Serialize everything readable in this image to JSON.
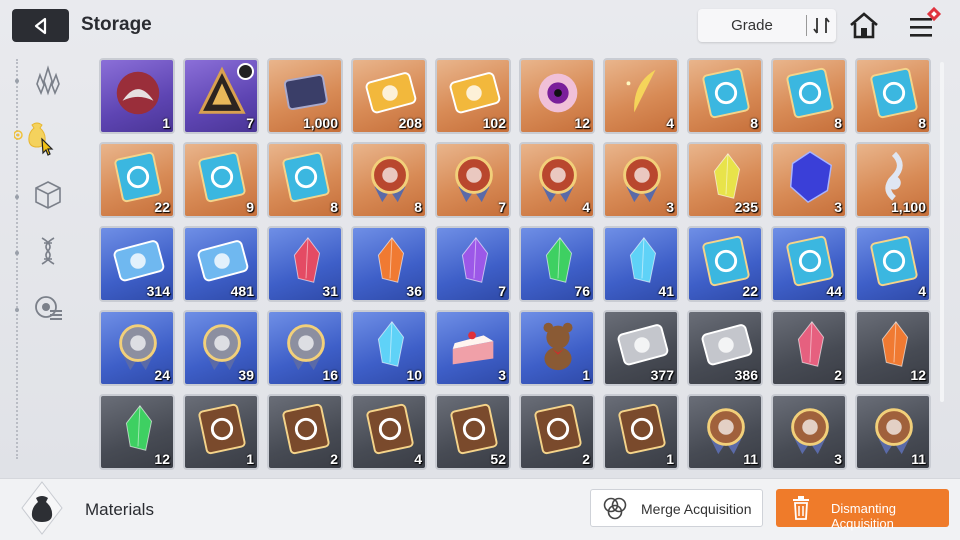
{
  "header": {
    "title": "Storage",
    "grade_label": "Grade"
  },
  "sidebar": {
    "categories": [
      {
        "name": "crystal",
        "active": false
      },
      {
        "name": "bag",
        "active": true
      },
      {
        "name": "cube",
        "active": false
      },
      {
        "name": "dna",
        "active": false
      },
      {
        "name": "chip",
        "active": false
      }
    ]
  },
  "items": [
    {
      "rarity": "purple",
      "icon": "monster-core",
      "count": "1"
    },
    {
      "rarity": "purple",
      "icon": "triangle-relic",
      "count": "7",
      "timer": true
    },
    {
      "rarity": "orange",
      "icon": "chip-card",
      "count": "1,000"
    },
    {
      "rarity": "orange",
      "icon": "gold-ticket",
      "count": "208"
    },
    {
      "rarity": "orange",
      "icon": "gold-ticket-rainbow",
      "count": "102"
    },
    {
      "rarity": "orange",
      "icon": "purple-eye",
      "count": "12"
    },
    {
      "rarity": "orange",
      "icon": "gold-feather",
      "count": "4"
    },
    {
      "rarity": "orange",
      "icon": "sword-book",
      "count": "8"
    },
    {
      "rarity": "orange",
      "icon": "shield-book",
      "count": "8"
    },
    {
      "rarity": "orange",
      "icon": "eye-book",
      "count": "8"
    },
    {
      "rarity": "orange",
      "icon": "sword-book",
      "count": "22"
    },
    {
      "rarity": "orange",
      "icon": "target-book",
      "count": "9"
    },
    {
      "rarity": "orange",
      "icon": "globe-book",
      "count": "8"
    },
    {
      "rarity": "orange",
      "icon": "sword-medal",
      "count": "8"
    },
    {
      "rarity": "orange",
      "icon": "shield-medal",
      "count": "7"
    },
    {
      "rarity": "orange",
      "icon": "arrow-medal",
      "count": "4"
    },
    {
      "rarity": "orange",
      "icon": "star-medal",
      "count": "3"
    },
    {
      "rarity": "orange",
      "icon": "yellow-crystal",
      "count": "235"
    },
    {
      "rarity": "orange",
      "icon": "blue-cube",
      "count": "3"
    },
    {
      "rarity": "orange",
      "icon": "music-clef",
      "count": "1,100"
    },
    {
      "rarity": "blue",
      "icon": "blue-ticket",
      "count": "314"
    },
    {
      "rarity": "blue",
      "icon": "compass-ticket",
      "count": "481"
    },
    {
      "rarity": "blue",
      "icon": "red-crystal",
      "count": "31"
    },
    {
      "rarity": "blue",
      "icon": "orange-crystal",
      "count": "36"
    },
    {
      "rarity": "blue",
      "icon": "purple-crystal",
      "count": "7"
    },
    {
      "rarity": "blue",
      "icon": "green-crystal",
      "count": "76"
    },
    {
      "rarity": "blue",
      "icon": "cyan-crystal",
      "count": "41"
    },
    {
      "rarity": "blue",
      "icon": "shield-book-blue",
      "count": "22"
    },
    {
      "rarity": "blue",
      "icon": "eye-book-blue",
      "count": "44"
    },
    {
      "rarity": "blue",
      "icon": "sword-book-blue",
      "count": "4"
    },
    {
      "rarity": "blue",
      "icon": "silver-medal-shield",
      "count": "24"
    },
    {
      "rarity": "blue",
      "icon": "silver-medal-eye",
      "count": "39"
    },
    {
      "rarity": "blue",
      "icon": "silver-medal-globe",
      "count": "16"
    },
    {
      "rarity": "blue",
      "icon": "ice-shard",
      "count": "10"
    },
    {
      "rarity": "blue",
      "icon": "cake",
      "count": "3"
    },
    {
      "rarity": "blue",
      "icon": "teddy-bear",
      "count": "1"
    },
    {
      "rarity": "gray",
      "icon": "gray-ticket",
      "count": "377"
    },
    {
      "rarity": "gray",
      "icon": "gray-compass-ticket",
      "count": "386"
    },
    {
      "rarity": "gray",
      "icon": "pink-crystal",
      "count": "2"
    },
    {
      "rarity": "gray",
      "icon": "orange-crystal-gray",
      "count": "12"
    },
    {
      "rarity": "gray",
      "icon": "green-crystal-gray",
      "count": "12"
    },
    {
      "rarity": "gray",
      "icon": "sword-brown-book",
      "count": "1"
    },
    {
      "rarity": "gray",
      "icon": "shield-brown-book",
      "count": "2"
    },
    {
      "rarity": "gray",
      "icon": "eye-brown-book",
      "count": "4"
    },
    {
      "rarity": "gray",
      "icon": "sword-brown-book",
      "count": "52"
    },
    {
      "rarity": "gray",
      "icon": "target-brown-book",
      "count": "2"
    },
    {
      "rarity": "gray",
      "icon": "globe-brown-book",
      "count": "1"
    },
    {
      "rarity": "gray",
      "icon": "bronze-medal-sword",
      "count": "11"
    },
    {
      "rarity": "gray",
      "icon": "bronze-medal-shield",
      "count": "3"
    },
    {
      "rarity": "gray",
      "icon": "bronze-medal-arrow",
      "count": "11"
    }
  ],
  "footer": {
    "category_label": "Materials",
    "merge_label": "Merge Acquisition",
    "dismantle_label": "Dismanting Acquisition"
  },
  "colors": {
    "accent": "#ef7b2a",
    "back_bg": "#2b2d33"
  }
}
